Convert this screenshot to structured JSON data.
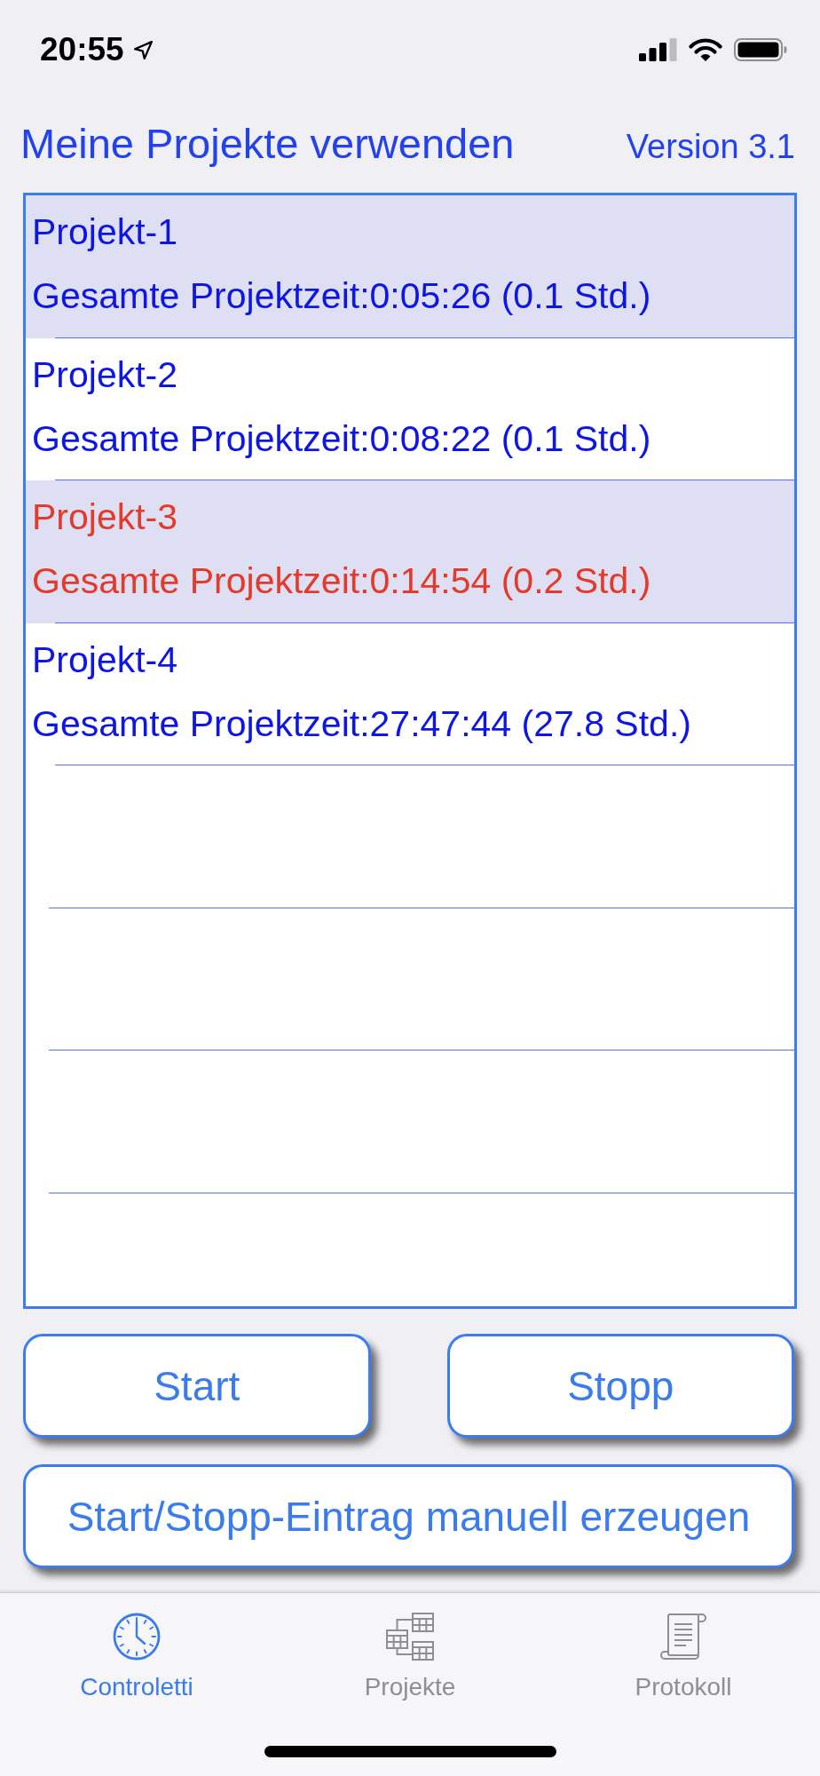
{
  "status_bar": {
    "time": "20:55"
  },
  "header": {
    "title": "Meine Projekte verwenden",
    "version": "Version 3.1"
  },
  "projects": [
    {
      "name": "Projekt-1",
      "total": "Gesamte Projektzeit:0:05:26 (0.1 Std.)",
      "selected": true,
      "running": false
    },
    {
      "name": "Projekt-2",
      "total": "Gesamte Projektzeit:0:08:22 (0.1 Std.)",
      "selected": false,
      "running": false
    },
    {
      "name": "Projekt-3",
      "total": "Gesamte Projektzeit:0:14:54 (0.2 Std.)",
      "selected": true,
      "running": true
    },
    {
      "name": "Projekt-4",
      "total": "Gesamte Projektzeit:27:47:44 (27.8 Std.)",
      "selected": false,
      "running": false
    }
  ],
  "buttons": [
    {
      "label": "Start"
    },
    {
      "label": "Stopp"
    },
    {
      "label": "Start/Stopp-Eintrag manuell erzeugen"
    }
  ],
  "tab_bar": {
    "tabs": [
      {
        "label": "Controletti",
        "selected": true
      },
      {
        "label": "Projekte",
        "selected": false
      },
      {
        "label": "Protokoll",
        "selected": false
      }
    ]
  }
}
